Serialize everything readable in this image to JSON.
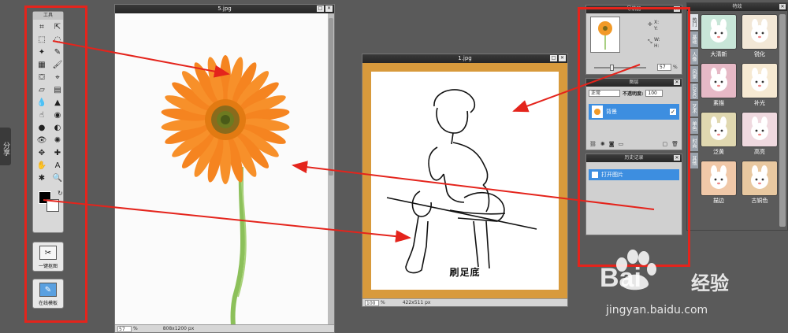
{
  "share_tab": "分享",
  "toolbox": {
    "title": "工具",
    "tools": [
      "crop-icon",
      "move-icon",
      "marquee-icon",
      "lasso-icon",
      "magic-wand-icon",
      "pencil-icon",
      "gradient-icon",
      "brush-icon",
      "clone-stamp-icon",
      "eyedropper-icon",
      "eraser-icon",
      "text-icon",
      "blur-icon",
      "sharpen-icon",
      "smudge-icon",
      "sponge-icon",
      "dodge-icon",
      "burn-icon",
      "red-eye-icon",
      "bloat-icon",
      "pinch-icon",
      "spot-heal-icon",
      "hand-icon",
      "type-icon",
      "sparkle-icon",
      "zoom-icon"
    ],
    "one_click_cutout": "一键抠图",
    "online_template": "在线模板"
  },
  "window_flower": {
    "title": "5.jpg",
    "zoom": "57",
    "zoom_unit": "%",
    "size": "808x1200 px"
  },
  "window_sketch": {
    "title": "1.jpg",
    "zoom": "100",
    "zoom_unit": "%",
    "size": "422x511 px",
    "caption": "刷足底"
  },
  "navigator": {
    "title": "导航器",
    "x_label": "X:",
    "y_label": "Y:",
    "w_label": "W:",
    "h_label": "H:",
    "zoom": "57",
    "zoom_unit": "%"
  },
  "layers": {
    "title": "图层",
    "blend_mode": "正常",
    "opacity_label": "不透明度:",
    "opacity_value": "100",
    "layer_name": "背景"
  },
  "history": {
    "title": "历史记录",
    "items": [
      "打开图片"
    ]
  },
  "effects": {
    "title": "特效",
    "tabs": [
      "热门",
      "基础",
      "人像",
      "风景",
      "LOMO",
      "艺术",
      "单色",
      "时尚",
      "其他"
    ],
    "items": [
      {
        "label": "大清新",
        "tint": "#c8e6d8"
      },
      {
        "label": "锐化",
        "tint": "#f2e7d6"
      },
      {
        "label": "素描",
        "tint": "#e6b9c6"
      },
      {
        "label": "补光",
        "tint": "#f6e9d2"
      },
      {
        "label": "泛黄",
        "tint": "#e0d8b0"
      },
      {
        "label": "高亮",
        "tint": "#efd9df"
      },
      {
        "label": "描边",
        "tint": "#f0c8a8"
      },
      {
        "label": "古铜色",
        "tint": "#e8c8a0"
      }
    ]
  },
  "watermark": {
    "brand": "Bai",
    "brand2": "经验",
    "url": "jingyan.baidu.com"
  }
}
